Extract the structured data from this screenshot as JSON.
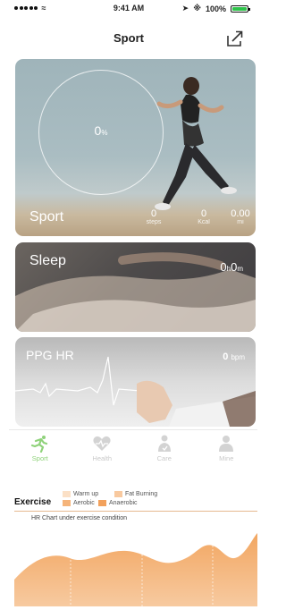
{
  "status_bar": {
    "time": "9:41 AM",
    "battery": "100%"
  },
  "header": {
    "title": "Sport"
  },
  "sport_card": {
    "label": "Sport",
    "ring_value": "0",
    "ring_unit": "%",
    "stats": [
      {
        "value": "0",
        "unit": "steps"
      },
      {
        "value": "0",
        "unit": "Kcal"
      },
      {
        "value": "0.00",
        "unit": "mi"
      }
    ]
  },
  "sleep_card": {
    "label": "Sleep",
    "hours": "0",
    "hours_unit": "h",
    "minutes": "0",
    "minutes_unit": "m"
  },
  "ppg_card": {
    "label": "PPG HR",
    "value": "0",
    "unit": "bpm"
  },
  "tabs": [
    {
      "label": "Sport",
      "icon": "runner-icon",
      "active": true
    },
    {
      "label": "Health",
      "icon": "heart-icon",
      "active": false
    },
    {
      "label": "Care",
      "icon": "care-icon",
      "active": false
    },
    {
      "label": "Mine",
      "icon": "person-icon",
      "active": false
    }
  ],
  "exercise": {
    "title": "Exercise",
    "legend": [
      {
        "label": "Warm up",
        "color": "#fbe0c6"
      },
      {
        "label": "Fat Burning",
        "color": "#f8c99f"
      },
      {
        "label": "Aerobic",
        "color": "#f5b47a"
      },
      {
        "label": "Anaerobic",
        "color": "#f2a15c"
      }
    ],
    "subtitle": "HR Chart under exercise condition"
  },
  "colors": {
    "accent_green": "#8fd27a",
    "battery_green": "#2ec34a",
    "chart_orange": "#f2a661"
  }
}
